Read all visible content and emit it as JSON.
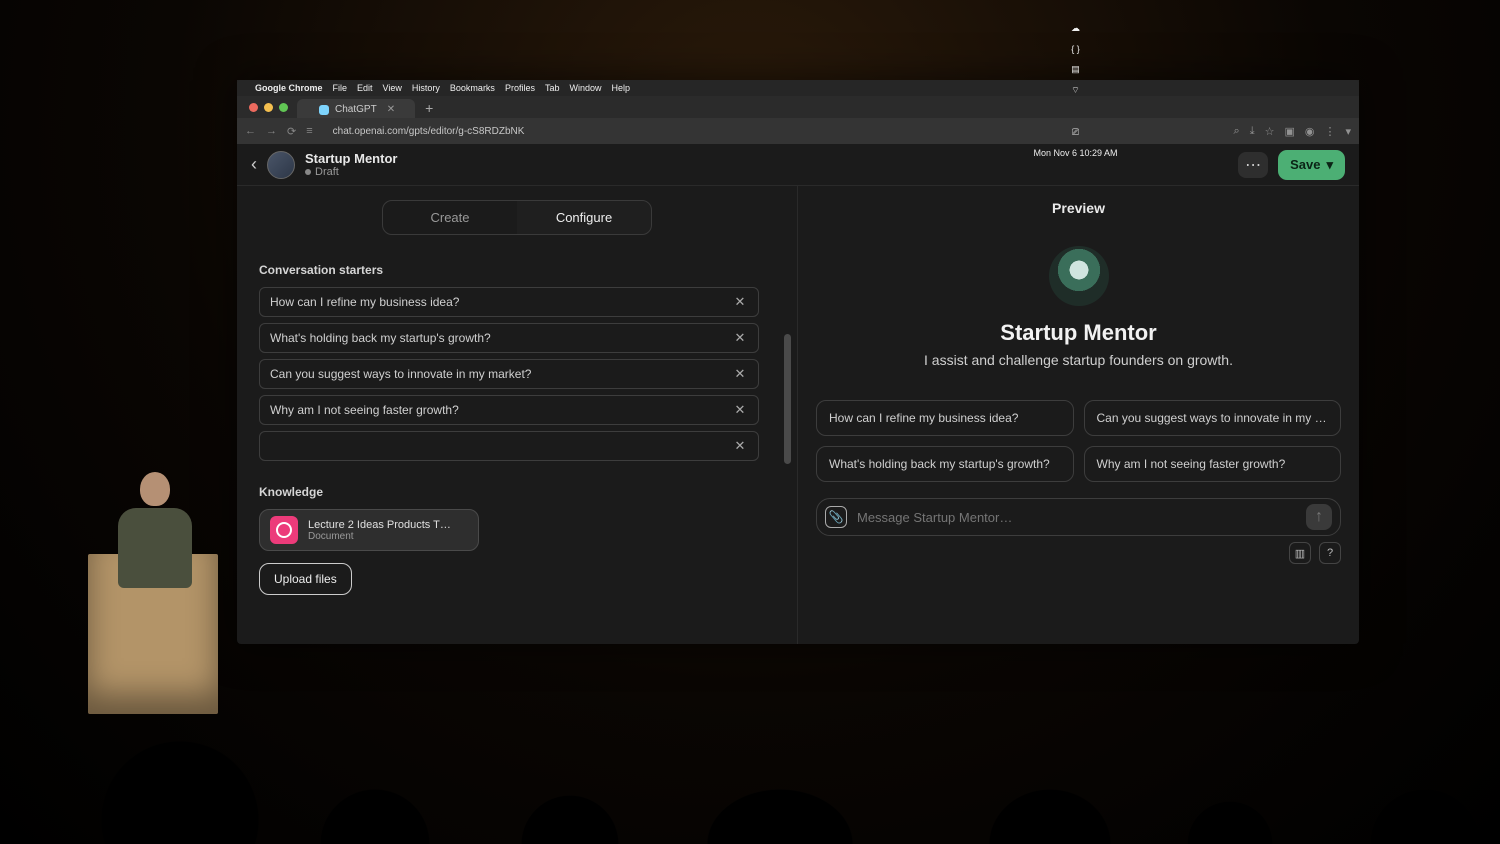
{
  "menubar": {
    "app": "Google Chrome",
    "items": [
      "File",
      "Edit",
      "View",
      "History",
      "Bookmarks",
      "Profiles",
      "Tab",
      "Window",
      "Help"
    ],
    "datetime": "Mon Nov 6  10:29 AM"
  },
  "browser": {
    "tab_title": "ChatGPT",
    "url": "chat.openai.com/gpts/editor/g-cS8RDZbNK"
  },
  "header": {
    "title": "Startup Mentor",
    "status": "Draft",
    "save_label": "Save"
  },
  "tabs": {
    "create": "Create",
    "configure": "Configure"
  },
  "left": {
    "starters_label": "Conversation starters",
    "starters": [
      "How can I refine my business idea?",
      "What's holding back my startup's growth?",
      "Can you suggest ways to innovate in my market?",
      "Why am I not seeing faster growth?",
      ""
    ],
    "knowledge_label": "Knowledge",
    "file": {
      "name": "Lecture 2 Ideas Products T…",
      "type": "Document"
    },
    "upload_label": "Upload files"
  },
  "preview": {
    "label": "Preview",
    "name": "Startup Mentor",
    "tagline": "I assist and challenge startup founders on growth.",
    "chips": [
      "How can I refine my business idea?",
      "Can you suggest ways to innovate in my …",
      "What's holding back my startup's growth?",
      "Why am I not seeing faster growth?"
    ],
    "placeholder": "Message Startup Mentor…"
  }
}
